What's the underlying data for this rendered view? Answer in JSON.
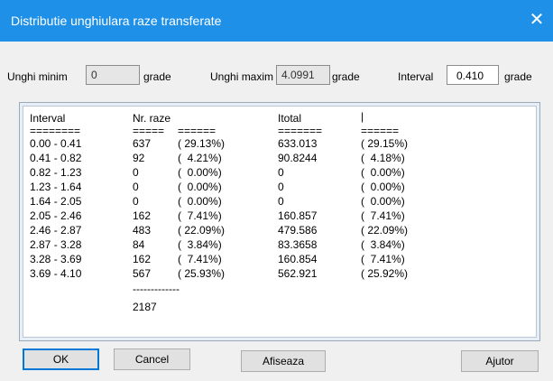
{
  "window": {
    "title": "Distributie unghiulara raze transferate",
    "close_icon": "close-icon"
  },
  "params": {
    "min_label": "Unghi minim",
    "min_value": "0",
    "min_unit": "grade",
    "max_label": "Unghi maxim",
    "max_value": "4.0991",
    "max_unit": "grade",
    "interval_label": "Interval",
    "interval_value": "0.410",
    "interval_unit": "grade"
  },
  "table": {
    "headers": {
      "interval": "Interval",
      "nr": "Nr. raze",
      "itotal": "Itotal"
    },
    "sep": {
      "c1": "========",
      "c2": "=====",
      "c3": "======",
      "c4": "=======",
      "c5": "======"
    },
    "rows": [
      [
        "0.00 - 0.41",
        "637",
        "( 29.13%)",
        "633.013",
        "( 29.15%)"
      ],
      [
        "0.41 - 0.82",
        "92",
        "(  4.21%)",
        "90.8244",
        "(  4.18%)"
      ],
      [
        "0.82 - 1.23",
        "0",
        "(  0.00%)",
        "0",
        "(  0.00%)"
      ],
      [
        "1.23 - 1.64",
        "0",
        "(  0.00%)",
        "0",
        "(  0.00%)"
      ],
      [
        "1.64 - 2.05",
        "0",
        "(  0.00%)",
        "0",
        "(  0.00%)"
      ],
      [
        "2.05 - 2.46",
        "162",
        "(  7.41%)",
        "160.857",
        "(  7.41%)"
      ],
      [
        "2.46 - 2.87",
        "483",
        "( 22.09%)",
        "479.586",
        "( 22.09%)"
      ],
      [
        "2.87 - 3.28",
        "84",
        "(  3.84%)",
        "83.3658",
        "(  3.84%)"
      ],
      [
        "3.28 - 3.69",
        "162",
        "(  7.41%)",
        "160.854",
        "(  7.41%)"
      ],
      [
        "3.69 - 4.10",
        "567",
        "( 25.93%)",
        "562.921",
        "( 25.92%)"
      ]
    ],
    "total_sep": "-------------",
    "total": "2187"
  },
  "buttons": {
    "ok": "OK",
    "cancel": "Cancel",
    "show": "Afiseaza",
    "help": "Ajutor"
  }
}
